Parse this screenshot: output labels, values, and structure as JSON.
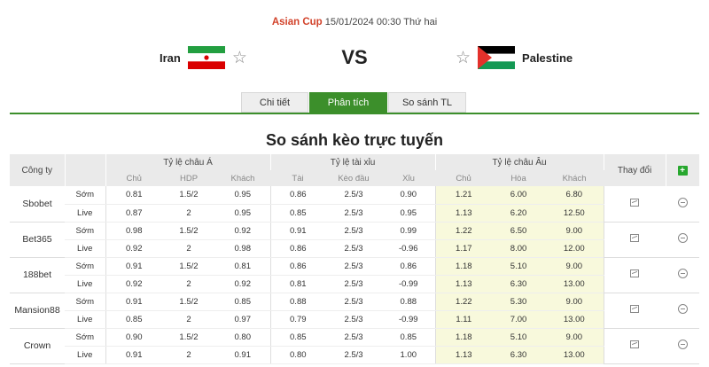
{
  "match": {
    "league": "Asian Cup",
    "datetime": "15/01/2024 00:30 Thứ hai",
    "home": "Iran",
    "away": "Palestine",
    "vs": "VS"
  },
  "tabs": [
    "Chi tiết",
    "Phân tích",
    "So sánh TL"
  ],
  "active_tab": "Phân tích",
  "title": "So sánh kèo trực tuyến",
  "table": {
    "company_header": "Công ty",
    "change_header": "Thay đổi",
    "groups": [
      "Tỷ lệ châu Á",
      "Tỷ lệ tài xỉu",
      "Tỷ lệ châu Âu"
    ],
    "sub_headers": [
      "Chủ",
      "HDP",
      "Khách",
      "Tài",
      "Kèo đầu",
      "Xỉu",
      "Chủ",
      "Hòa",
      "Khách"
    ],
    "bookmakers": [
      {
        "name": "Sbobet",
        "rows": [
          {
            "type": "Sớm",
            "v": [
              "0.81",
              "1.5/2",
              "0.95",
              "0.86",
              "2.5/3",
              "0.90",
              "1.21",
              "6.00",
              "6.80"
            ]
          },
          {
            "type": "Live",
            "v": [
              "0.87",
              "2",
              "0.95",
              "0.85",
              "2.5/3",
              "0.95",
              "1.13",
              "6.20",
              "12.50"
            ]
          }
        ]
      },
      {
        "name": "Bet365",
        "rows": [
          {
            "type": "Sớm",
            "v": [
              "0.98",
              "1.5/2",
              "0.92",
              "0.91",
              "2.5/3",
              "0.99",
              "1.22",
              "6.50",
              "9.00"
            ]
          },
          {
            "type": "Live",
            "v": [
              "0.92",
              "2",
              "0.98",
              "0.86",
              "2.5/3",
              "-0.96",
              "1.17",
              "8.00",
              "12.00"
            ]
          }
        ]
      },
      {
        "name": "188bet",
        "rows": [
          {
            "type": "Sớm",
            "v": [
              "0.91",
              "1.5/2",
              "0.81",
              "0.86",
              "2.5/3",
              "0.86",
              "1.18",
              "5.10",
              "9.00"
            ]
          },
          {
            "type": "Live",
            "v": [
              "0.92",
              "2",
              "0.92",
              "0.81",
              "2.5/3",
              "-0.99",
              "1.13",
              "6.30",
              "13.00"
            ]
          }
        ]
      },
      {
        "name": "Mansion88",
        "rows": [
          {
            "type": "Sớm",
            "v": [
              "0.91",
              "1.5/2",
              "0.85",
              "0.88",
              "2.5/3",
              "0.88",
              "1.22",
              "5.30",
              "9.00"
            ]
          },
          {
            "type": "Live",
            "v": [
              "0.85",
              "2",
              "0.97",
              "0.79",
              "2.5/3",
              "-0.99",
              "1.11",
              "7.00",
              "13.00"
            ]
          }
        ]
      },
      {
        "name": "Crown",
        "rows": [
          {
            "type": "Sớm",
            "v": [
              "0.90",
              "1.5/2",
              "0.80",
              "0.85",
              "2.5/3",
              "0.85",
              "1.18",
              "5.10",
              "9.00"
            ]
          },
          {
            "type": "Live",
            "v": [
              "0.91",
              "2",
              "0.91",
              "0.80",
              "2.5/3",
              "1.00",
              "1.13",
              "6.30",
              "13.00"
            ]
          }
        ]
      }
    ]
  },
  "icons": {
    "add": "plus-icon",
    "history": "line-chart-icon",
    "collapse": "minus-circle-icon",
    "favorite": "star-outline-icon"
  },
  "colors": {
    "accent": "#3c8f2b",
    "league": "#d2432b",
    "euro_bg": "#f8f9dc",
    "plus": "#27a72e"
  }
}
